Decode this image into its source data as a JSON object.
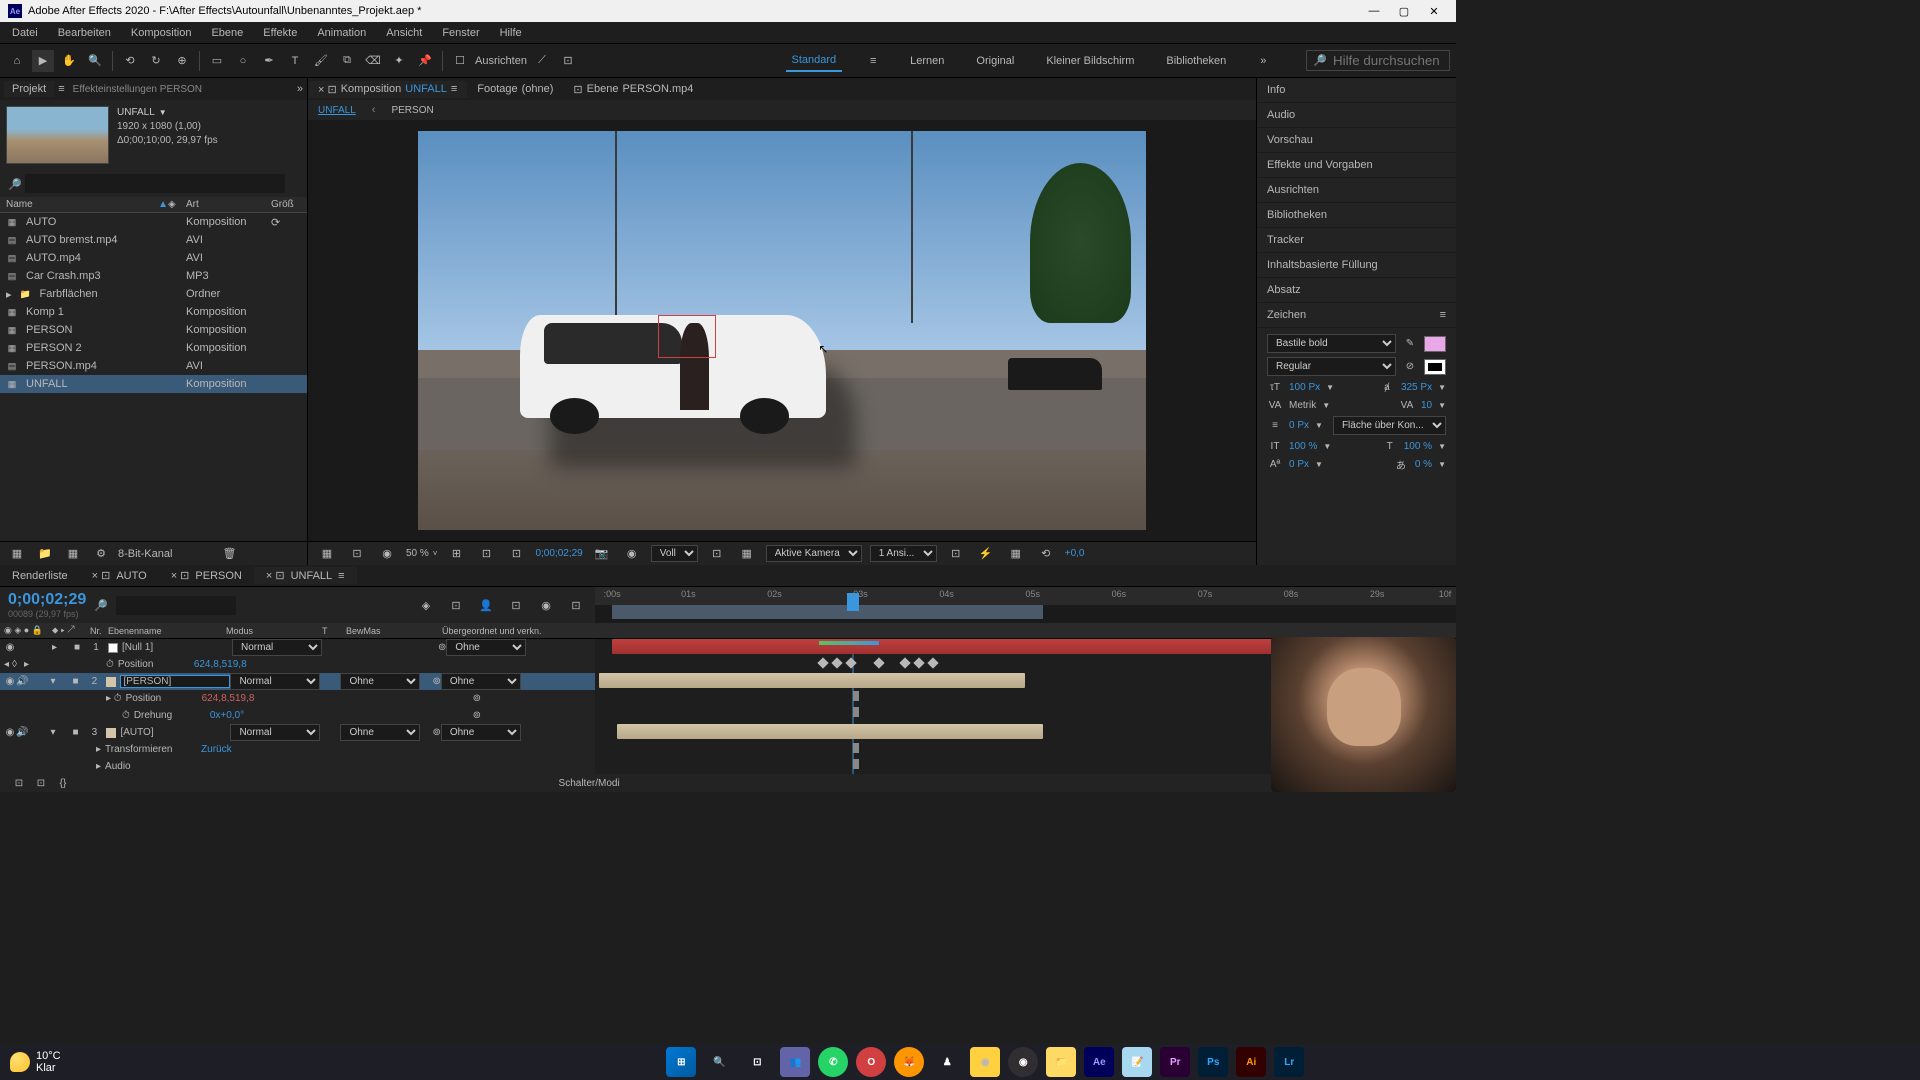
{
  "titlebar": {
    "app": "Adobe After Effects 2020",
    "path": "F:\\After Effects\\Autounfall\\Unbenanntes_Projekt.aep *"
  },
  "menu": [
    "Datei",
    "Bearbeiten",
    "Komposition",
    "Ebene",
    "Effekte",
    "Animation",
    "Ansicht",
    "Fenster",
    "Hilfe"
  ],
  "toolbar": {
    "ausrichten": "Ausrichten",
    "workspaces": [
      "Standard",
      "Lernen",
      "Original",
      "Kleiner Bildschirm",
      "Bibliotheken"
    ],
    "active_ws": "Standard",
    "search_placeholder": "Hilfe durchsuchen"
  },
  "left": {
    "tabs": {
      "projekt": "Projekt",
      "effects": "Effekteinstellungen PERSON"
    },
    "comp_name": "UNFALL",
    "comp_res": "1920 x 1080 (1,00)",
    "comp_dur": "Δ0;00;10;00, 29,97 fps",
    "cols": {
      "name": "Name",
      "art": "Art",
      "grob": "Größ"
    },
    "items": [
      {
        "name": "AUTO",
        "art": "Komposition",
        "type": "comp"
      },
      {
        "name": "AUTO bremst.mp4",
        "art": "AVI",
        "type": "avi"
      },
      {
        "name": "AUTO.mp4",
        "art": "AVI",
        "type": "avi"
      },
      {
        "name": "Car Crash.mp3",
        "art": "MP3",
        "type": "audio"
      },
      {
        "name": "Farbflächen",
        "art": "Ordner",
        "type": "folder"
      },
      {
        "name": "Komp 1",
        "art": "Komposition",
        "type": "comp"
      },
      {
        "name": "PERSON",
        "art": "Komposition",
        "type": "comp"
      },
      {
        "name": "PERSON 2",
        "art": "Komposition",
        "type": "comp"
      },
      {
        "name": "PERSON.mp4",
        "art": "AVI",
        "type": "avi"
      },
      {
        "name": "UNFALL",
        "art": "Komposition",
        "type": "comp",
        "sel": true
      }
    ],
    "footer_bpc": "8-Bit-Kanal"
  },
  "center": {
    "tab_komp": "Komposition",
    "tab_komp_name": "UNFALL",
    "tab_footage": "Footage",
    "tab_footage_val": "(ohne)",
    "tab_ebene": "Ebene",
    "tab_ebene_val": "PERSON.mp4",
    "subtabs": [
      "UNFALL",
      "PERSON"
    ],
    "zoom": "50 %",
    "timecode": "0;00;02;29",
    "voll": "Voll",
    "camera": "Aktive Kamera",
    "views": "1 Ansi...",
    "exposure": "+0,0"
  },
  "right": {
    "sections": [
      "Info",
      "Audio",
      "Vorschau",
      "Effekte und Vorgaben",
      "Ausrichten",
      "Bibliotheken",
      "Tracker",
      "Inhaltsbasierte Füllung",
      "Absatz",
      "Zeichen"
    ],
    "font": "Bastile bold",
    "style": "Regular",
    "size": "100 Px",
    "leading": "325 Px",
    "kerning": "Metrik",
    "tracking": "10",
    "stroke": "0 Px",
    "stroke_mode": "Fläche über Kon...",
    "vscale": "100 %",
    "hscale": "100 %",
    "baseline": "0 Px",
    "tsume": "0 %"
  },
  "timeline": {
    "tabs": [
      "Renderliste",
      "AUTO",
      "PERSON",
      "UNFALL"
    ],
    "active": "UNFALL",
    "timecode": "0;00;02;29",
    "timecode_sub": "00089 (29,97 fps)",
    "cols": {
      "nr": "Nr.",
      "name": "Ebenenname",
      "modus": "Modus",
      "t": "T",
      "bewmas": "BewMas",
      "parent": "Übergeordnet und verkn."
    },
    "ruler": [
      ":00s",
      "01s",
      "02s",
      "03s",
      "04s",
      "05s",
      "06s",
      "07s",
      "08s",
      "29s",
      "10f"
    ],
    "layers": [
      {
        "num": "1",
        "name": "[Null 1]",
        "mode": "Normal",
        "parent": "Ohne",
        "color": "#c04040"
      },
      {
        "prop": "Position",
        "val": "624,8,519,8"
      },
      {
        "num": "2",
        "name": "[PERSON]",
        "mode": "Normal",
        "bewmas": "Ohne",
        "parent": "Ohne",
        "color": "#d4c4a8",
        "sel": true
      },
      {
        "prop": "Position",
        "val": "624,8,519,8",
        "red": true
      },
      {
        "prop": "Drehung",
        "val": "0x+0,0°"
      },
      {
        "num": "3",
        "name": "[AUTO]",
        "mode": "Normal",
        "bewmas": "Ohne",
        "parent": "Ohne",
        "color": "#d4c4a8"
      },
      {
        "prop": "Transformieren",
        "val": "Zurück"
      },
      {
        "prop": "Audio",
        "val": ""
      }
    ],
    "footer": "Schalter/Modi"
  },
  "weather": {
    "temp": "10°C",
    "cond": "Klar"
  }
}
